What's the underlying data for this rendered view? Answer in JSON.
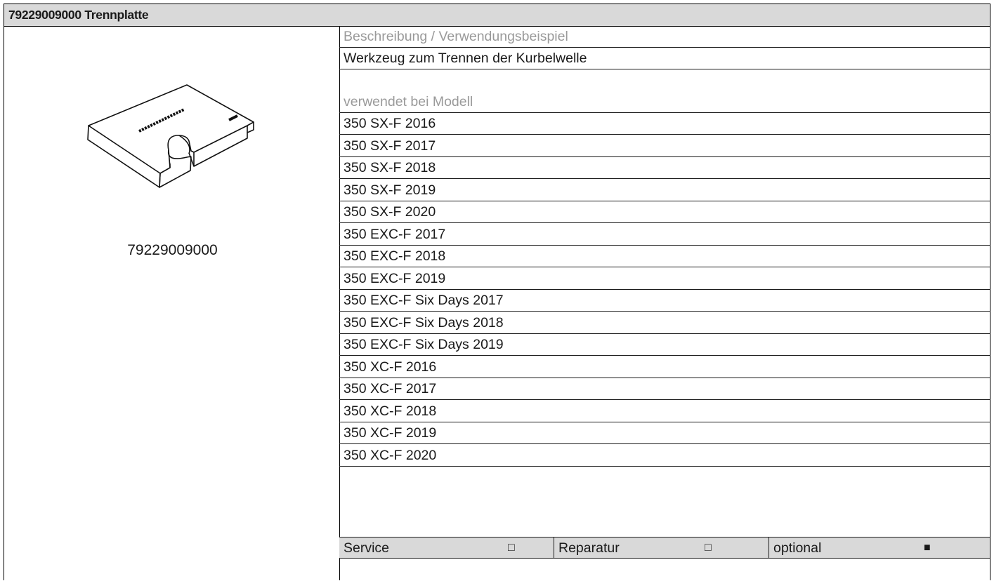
{
  "title": "79229009000 Trennplatte",
  "part_number": "79229009000",
  "description_label": "Beschreibung / Verwendungsbeispiel",
  "description": "Werkzeug zum Trennen der Kurbelwelle",
  "models_label": "verwendet bei Modell",
  "models": [
    "350 SX-F 2016",
    "350 SX-F 2017",
    "350 SX-F 2018",
    "350 SX-F 2019",
    "350 SX-F 2020",
    "350 EXC-F 2017",
    "350 EXC-F 2018",
    "350 EXC-F 2019",
    "350 EXC-F Six Days 2017",
    "350 EXC-F Six Days 2018",
    "350 EXC-F Six Days 2019",
    "350 XC-F 2016",
    "350 XC-F 2017",
    "350 XC-F 2018",
    "350 XC-F 2019",
    "350 XC-F 2020"
  ],
  "categories": [
    {
      "label": "Service",
      "symbol": "□"
    },
    {
      "label": "Reparatur",
      "symbol": "□"
    },
    {
      "label": "optional",
      "symbol": "■"
    }
  ],
  "drawing_icon": "separator-plate-drawing-icon"
}
